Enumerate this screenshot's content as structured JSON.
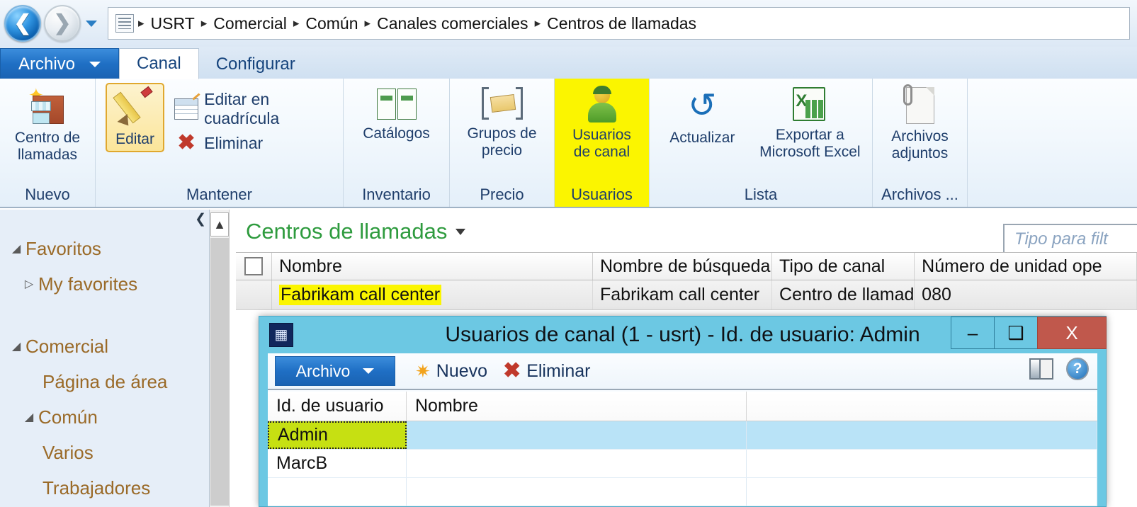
{
  "address_bar": {
    "back_icon": "back-arrow",
    "forward_icon": "forward-arrow",
    "history_icon": "history-dropdown",
    "breadcrumb": [
      "USRT",
      "Comercial",
      "Común",
      "Canales comerciales",
      "Centros de llamadas"
    ],
    "separator": "▸"
  },
  "tabs": {
    "file_label": "Archivo",
    "items": [
      {
        "label": "Canal",
        "active": true
      },
      {
        "label": "Configurar",
        "active": false
      }
    ]
  },
  "ribbon": {
    "groups": [
      {
        "title": "Nuevo",
        "buttons": [
          {
            "label": "Centro de\nllamadas",
            "label_line1": "Centro de",
            "label_line2": "llamadas",
            "icon": "store-icon"
          }
        ]
      },
      {
        "title": "Mantener",
        "selected_label": "Editar",
        "selected_icon": "pencil-icon",
        "small_buttons": [
          {
            "label": "Editar en cuadrícula",
            "icon": "grid-edit-icon"
          },
          {
            "label": "Eliminar",
            "icon": "red-x-icon"
          }
        ]
      },
      {
        "title": "Inventario",
        "buttons": [
          {
            "label_line1": "Catálogos",
            "label_line2": "",
            "icon": "catalog-book-icon"
          }
        ]
      },
      {
        "title": "Precio",
        "buttons": [
          {
            "label_line1": "Grupos de",
            "label_line2": "precio",
            "icon": "price-tag-icon"
          }
        ]
      },
      {
        "title": "Usuarios",
        "highlighted": true,
        "buttons": [
          {
            "label_line1": "Usuarios",
            "label_line2": "de canal",
            "icon": "user-icon"
          }
        ]
      },
      {
        "title": "Lista",
        "buttons": [
          {
            "label_line1": "Actualizar",
            "label_line2": "",
            "icon": "refresh-icon"
          },
          {
            "label_line1": "Exportar a",
            "label_line2": "Microsoft Excel",
            "icon": "excel-icon"
          }
        ]
      },
      {
        "title": "Archivos ...",
        "buttons": [
          {
            "label_line1": "Archivos",
            "label_line2": "adjuntos",
            "icon": "attachment-doc-icon"
          }
        ]
      }
    ]
  },
  "nav_pane": {
    "collapse_icon": "collapse-left-icon",
    "scroll_up_icon": "scroll-up-icon",
    "items": [
      {
        "label": "Favoritos",
        "level": 0,
        "expander": "expanded"
      },
      {
        "label": "My favorites",
        "level": 1,
        "expander": "collapsed"
      },
      {
        "label": "Comercial",
        "level": 0,
        "expander": "expanded"
      },
      {
        "label": "Página de área",
        "level": 2,
        "expander": "none"
      },
      {
        "label": "Común",
        "level": 1,
        "expander": "expanded"
      },
      {
        "label": "Varios",
        "level": 3,
        "expander": "none"
      },
      {
        "label": "Trabajadores",
        "level": 3,
        "expander": "none"
      }
    ]
  },
  "main": {
    "page_title": "Centros de llamadas",
    "filter_placeholder": "Tipo para filt",
    "grid": {
      "columns": [
        "Nombre",
        "Nombre de búsqueda",
        "Tipo de canal",
        "Número de unidad ope"
      ],
      "rows": [
        {
          "nombre": "Fabrikam call center",
          "nombre_busqueda": "Fabrikam call center",
          "tipo_canal": "Centro de llamadas",
          "numero_unidad": "080",
          "highlighted": true
        }
      ]
    }
  },
  "dialog": {
    "icon": "app-window-icon",
    "title": "Usuarios de canal (1 - usrt) - Id. de usuario: Admin",
    "window_buttons": [
      {
        "name": "minimize",
        "glyph": "–"
      },
      {
        "name": "maximize",
        "glyph": "❑"
      },
      {
        "name": "close",
        "glyph": "X"
      }
    ],
    "toolbar": {
      "file_label": "Archivo",
      "new_label": "Nuevo",
      "new_icon": "new-sun-icon",
      "delete_label": "Eliminar",
      "delete_icon": "red-x-icon",
      "layout_icon": "layout-icon",
      "help_icon": "help-icon"
    },
    "grid": {
      "columns": [
        "Id. de usuario",
        "Nombre"
      ],
      "rows": [
        {
          "user_id": "Admin",
          "nombre": "",
          "selected": true,
          "highlighted": true
        },
        {
          "user_id": "MarcB",
          "nombre": "",
          "selected": false,
          "highlighted": false
        },
        {
          "user_id": "",
          "nombre": "",
          "selected": false,
          "highlighted": false
        }
      ]
    }
  },
  "colors": {
    "highlight_yellow": "#fbf500",
    "highlight_green": "#c6e012",
    "dialog_titlebar": "#6cc8e3",
    "close_button": "#c0584c",
    "page_title_green": "#2e9b3e",
    "ribbon_text_blue": "#1f3e6b",
    "nav_text_brown": "#9a6a28"
  }
}
